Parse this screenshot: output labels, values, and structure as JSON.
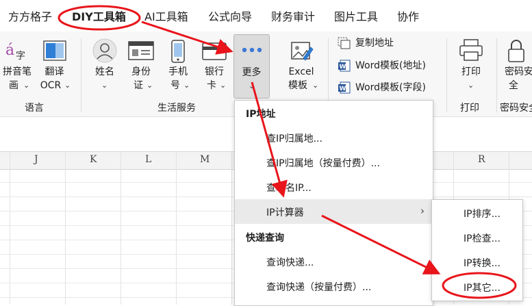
{
  "menubar": {
    "tabs": [
      "方方格子",
      "DIY工具箱",
      "AI工具箱",
      "公式向导",
      "财务审计",
      "图片工具",
      "协作"
    ],
    "active_tab": "DIY工具箱"
  },
  "ribbon": {
    "language_group": {
      "label": "语言",
      "pinyin": {
        "line1": "拼音笔",
        "line2": "画"
      },
      "translate": {
        "line1": "翻译",
        "line2": "OCR"
      }
    },
    "life_group": {
      "label": "生活服务",
      "name": {
        "line1": "姓名"
      },
      "idcard": {
        "line1": "身份",
        "line2": "证"
      },
      "phone": {
        "line1": "手机",
        "line2": "号"
      },
      "bank": {
        "line1": "银行",
        "line2": "卡"
      },
      "more": {
        "line1": "更多"
      }
    },
    "excel_template": {
      "line1": "Excel",
      "line2": "模板"
    },
    "copy_address": "复制地址",
    "word_template_addr": "Word模板(地址)",
    "word_template_field": "Word模板(字段)",
    "print_group": {
      "label": "打印",
      "button": "打印"
    },
    "security_group": {
      "label": "密码安全",
      "line1": "密码安",
      "line2": "全"
    }
  },
  "sheet": {
    "columns": [
      "J",
      "K",
      "L",
      "M",
      "R"
    ]
  },
  "dropdown": {
    "ip_header": "IP地址",
    "items_ip": [
      "查IP归属地...",
      "查IP归属地（按量付费）...",
      "查域名IP...",
      "IP计算器"
    ],
    "express_header": "快递查询",
    "items_express": [
      "查询快递...",
      "查询快递（按量付费）..."
    ]
  },
  "submenu": {
    "items": [
      "IP排序...",
      "IP检查...",
      "IP转换...",
      "IP其它..."
    ]
  },
  "colors": {
    "annotation": "#e8151b",
    "ribbon_bg": "#f7f7f7",
    "highlight": "#eaeaea",
    "word_blue": "#2b579a"
  }
}
